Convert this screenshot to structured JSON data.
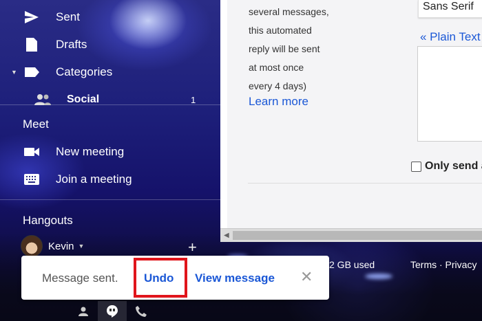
{
  "sidebar": {
    "items": [
      {
        "label": "Sent",
        "icon": "send-icon"
      },
      {
        "label": "Drafts",
        "icon": "draft-icon"
      },
      {
        "label": "Categories",
        "icon": "label-icon"
      },
      {
        "label": "Social",
        "icon": "people-icon",
        "count": "1"
      }
    ],
    "meet": {
      "title": "Meet",
      "items": [
        {
          "label": "New meeting",
          "icon": "video-icon"
        },
        {
          "label": "Join a meeting",
          "icon": "keyboard-icon"
        }
      ]
    },
    "hangouts": {
      "title": "Hangouts",
      "user": "Kevin"
    }
  },
  "settings": {
    "auto_reply_lines": [
      "several messages,",
      "this automated",
      "reply will be sent",
      "at most once",
      "every 4 days)"
    ],
    "learn_more": "Learn more",
    "font": "Sans Serif",
    "plain_text": "« Plain Text",
    "only_send": "Only send a"
  },
  "footer": {
    "storage": "2 GB used",
    "terms": "Terms · Privacy"
  },
  "snackbar": {
    "message": "Message sent.",
    "undo": "Undo",
    "view": "View message",
    "highlight_color": "#e0151b"
  },
  "colors": {
    "link": "#1a57d6",
    "sidebar_text": "#ffffff"
  }
}
